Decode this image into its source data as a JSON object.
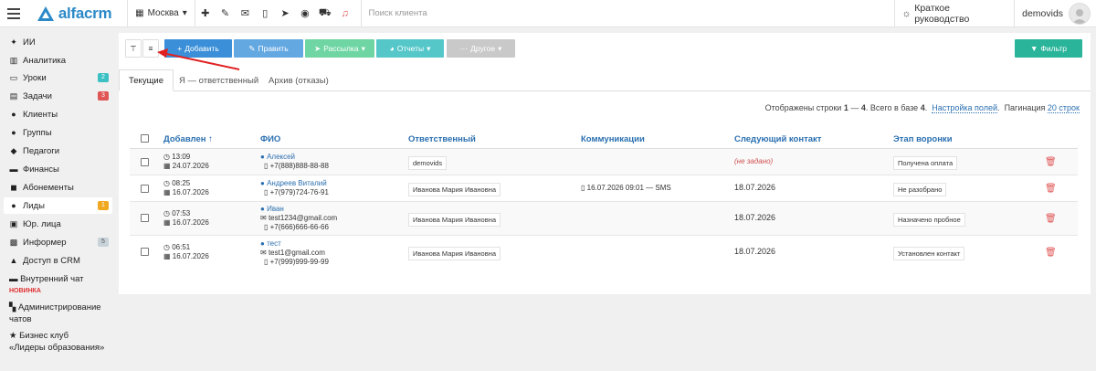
{
  "topbar": {
    "logo_text": "alfacrm",
    "city": "Москва",
    "icons": [
      "plus-icon",
      "wrench-icon",
      "envelope-icon",
      "phone-icon",
      "telegram-icon",
      "whatsapp-icon",
      "cart-icon",
      "bell-icon"
    ],
    "search_placeholder": "Поиск клиента",
    "guide_label": "Краткое руководство",
    "username": "demovids"
  },
  "sidebar": {
    "items": [
      {
        "label": "ИИ",
        "icon": "sparkles-icon"
      },
      {
        "label": "Аналитика",
        "icon": "chart-icon"
      },
      {
        "label": "Уроки",
        "icon": "lessons-icon",
        "badge": "2"
      },
      {
        "label": "Задачи",
        "icon": "tasks-icon",
        "badge": "3"
      },
      {
        "label": "Клиенты",
        "icon": "client-icon"
      },
      {
        "label": "Группы",
        "icon": "group-icon"
      },
      {
        "label": "Педагоги",
        "icon": "teacher-icon"
      },
      {
        "label": "Финансы",
        "icon": "finance-icon"
      },
      {
        "label": "Абонементы",
        "icon": "subscription-icon"
      },
      {
        "label": "Лиды",
        "icon": "lead-icon",
        "badge": "1"
      },
      {
        "label": "Юр. лица",
        "icon": "briefcase-icon"
      },
      {
        "label": "Информер",
        "icon": "informer-icon",
        "badge": "5"
      },
      {
        "label": "Доступ в CRM",
        "icon": "lock-icon"
      }
    ],
    "chat_label": "Внутренний чат",
    "chat_new": "НОВИНКА",
    "admin_line1": "Администрирование",
    "admin_line2": "чатов",
    "club_line1": "Бизнес клуб",
    "club_line2": "«Лидеры образования»"
  },
  "toolbar": {
    "add": "Добавить",
    "edit": "Править",
    "mailing": "Рассылка",
    "reports": "Отчеты",
    "other": "Другое",
    "filter": "Фильтр"
  },
  "tabs": [
    "Текущие",
    "Я — ответственный",
    "Архив (отказы)"
  ],
  "summary": {
    "text1": "Отображены строки",
    "range_from": "1",
    "text2": "—",
    "range_to": "4",
    "text3": ". Всего в базе",
    "total": "4",
    "dot": ".",
    "fields_link": "Настройка полей",
    "pagination_label": "Пагинация",
    "pagination_link": "20 строк"
  },
  "table": {
    "columns": [
      "Добавлен ↑",
      "ФИО",
      "Ответственный",
      "Коммуникации",
      "Следующий контакт",
      "Этап воронки"
    ],
    "rows": [
      {
        "time": "13:09",
        "date": "24.07.2026",
        "name": "Алексей",
        "email": "",
        "phone": "+7(888)888-88-88",
        "responsible": "demovids",
        "comm": "",
        "next": "(не задано)",
        "stage": "Получена оплата"
      },
      {
        "time": "08:25",
        "date": "16.07.2026",
        "name": "Андреев Виталий",
        "email": "",
        "phone": "+7(979)724-76-91",
        "responsible": "Иванова Мария Ивановна",
        "comm": "16.07.2026 09:01 — SMS",
        "next": "18.07.2026",
        "stage": "Не разобрано"
      },
      {
        "time": "07:53",
        "date": "16.07.2026",
        "name": "Иван",
        "email": "test1234@gmail.com",
        "phone": "+7(666)666-66-66",
        "responsible": "Иванова Мария Ивановна",
        "comm": "",
        "next": "18.07.2026",
        "stage": "Назначено пробное"
      },
      {
        "time": "06:51",
        "date": "16.07.2026",
        "name": "тест",
        "email": "test1@gmail.com",
        "phone": "+7(999)999-99-99",
        "responsible": "Иванова Мария Ивановна",
        "comm": "",
        "next": "18.07.2026",
        "stage": "Установлен контакт"
      }
    ]
  },
  "colors": {
    "accent": "#2c89c8",
    "arrow": "#e02020",
    "filter": "#2ab49a"
  }
}
